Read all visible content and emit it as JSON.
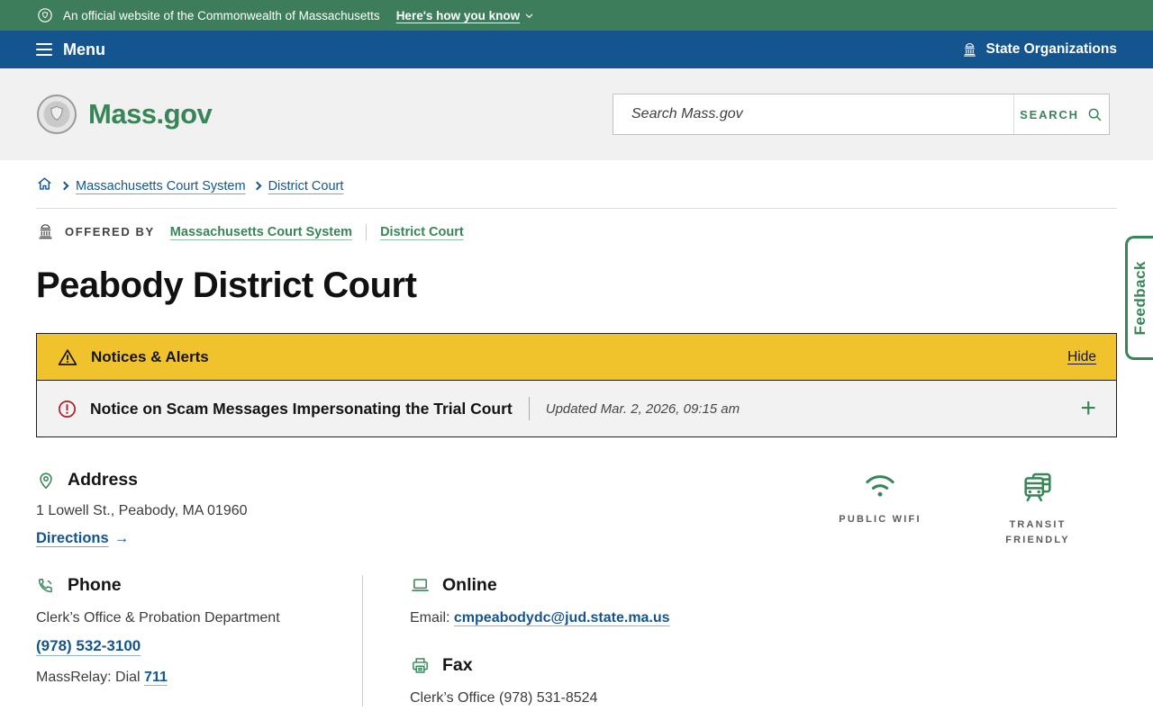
{
  "colors": {
    "brand_green": "#388557",
    "primary_blue": "#14558f",
    "banner_green": "#3e7d5c",
    "alert_yellow": "#f0c32c",
    "alert_red": "#b01e29"
  },
  "official_banner": {
    "seal_icon": "state-seal",
    "text": "An official website of the Commonwealth of Massachusetts",
    "link": "Here's how you know",
    "chevron_icon": "chevron-down"
  },
  "nav": {
    "menu_icon": "hamburger",
    "menu_label": "Menu",
    "state_orgs_icon": "capitol-building",
    "state_orgs_label": "State Organizations"
  },
  "header": {
    "logo_seal_icon": "massachusetts-state-seal",
    "logo_text": "Mass.gov",
    "search_placeholder": "Search Mass.gov",
    "search_value": "",
    "search_button_label": "SEARCH",
    "search_icon": "magnifier"
  },
  "breadcrumb": {
    "home_icon": "home",
    "items": [
      {
        "label": "Massachusetts Court System"
      },
      {
        "label": "District Court"
      }
    ]
  },
  "offered_by": {
    "icon": "capitol-building",
    "label": "OFFERED BY",
    "links": [
      {
        "label": "Massachusetts Court System"
      },
      {
        "label": "District Court"
      }
    ]
  },
  "page": {
    "title": "Peabody District Court"
  },
  "alerts": {
    "warning_icon": "warning-triangle",
    "header_label": "Notices & Alerts",
    "hide_label": "Hide",
    "notice_icon": "alert-circle",
    "notice_title": "Notice on Scam Messages Impersonating the Trial Court",
    "notice_updated": "Updated Mar. 2, 2026, 09:15 am",
    "expand_label": "+"
  },
  "address": {
    "icon": "location-pin",
    "heading": "Address",
    "line1": "1 Lowell St., Peabody, MA 01960",
    "directions_label": "Directions",
    "directions_arrow": "→"
  },
  "amenities": [
    {
      "icon": "wifi",
      "label": "PUBLIC WIFI"
    },
    {
      "icon": "transit",
      "label": "TRANSIT FRIENDLY"
    }
  ],
  "contact": {
    "phone": {
      "icon": "phone",
      "heading": "Phone",
      "department": "Clerk’s Office & Probation Department",
      "number": "(978) 532-3100",
      "relay_prefix": "MassRelay: Dial",
      "relay_number": "711"
    },
    "online": {
      "icon": "laptop",
      "heading": "Online",
      "email_label": "Email:",
      "email": "cmpeabodydc@jud.state.ma.us"
    },
    "fax": {
      "icon": "fax-machine",
      "heading": "Fax",
      "line": "Clerk’s Office (978) 531-8524"
    }
  },
  "feedback": {
    "label": "Feedback"
  }
}
